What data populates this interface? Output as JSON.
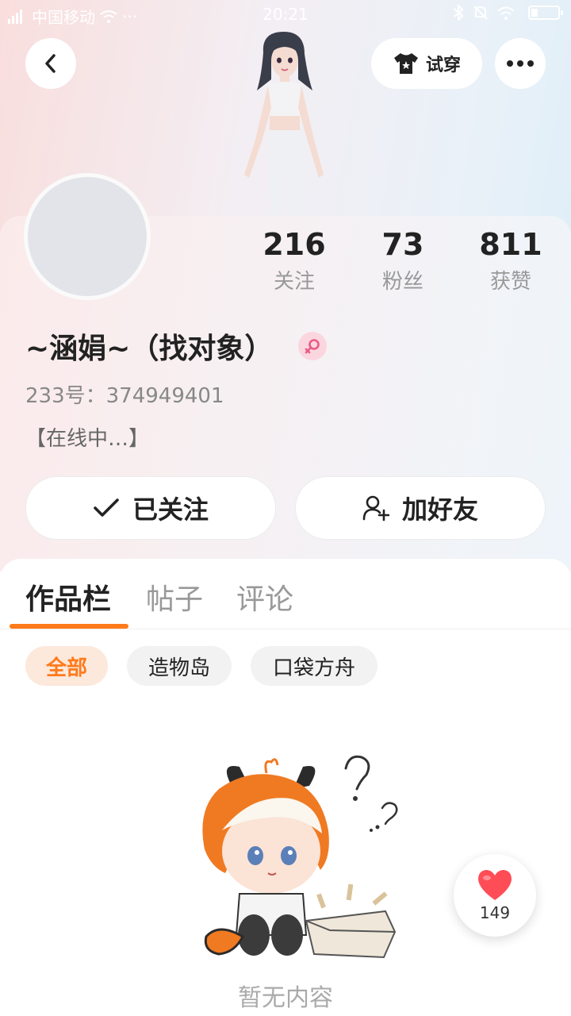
{
  "status_bar": {
    "carrier": "中国移动",
    "time": "20:21"
  },
  "header": {
    "tryon_label": "试穿"
  },
  "profile": {
    "username": "~涵娟~（找对象）",
    "uid": "233号：374949401",
    "bio": "【在线中…】",
    "gender": "female",
    "stats": [
      {
        "value": "216",
        "label": "关注"
      },
      {
        "value": "73",
        "label": "粉丝"
      },
      {
        "value": "811",
        "label": "获赞"
      }
    ]
  },
  "actions": {
    "followed_label": "已关注",
    "add_friend_label": "加好友"
  },
  "tabs": [
    {
      "label": "作品栏"
    },
    {
      "label": "帖子"
    },
    {
      "label": "评论"
    }
  ],
  "filters": [
    {
      "label": "全部"
    },
    {
      "label": "造物岛"
    },
    {
      "label": "口袋方舟"
    }
  ],
  "empty_state": {
    "text": "暂无内容"
  },
  "like_float": {
    "count": "149"
  },
  "colors": {
    "accent": "#ff7a1a",
    "chip_active_bg": "#fde8dc",
    "heart": "#ff4d57"
  }
}
